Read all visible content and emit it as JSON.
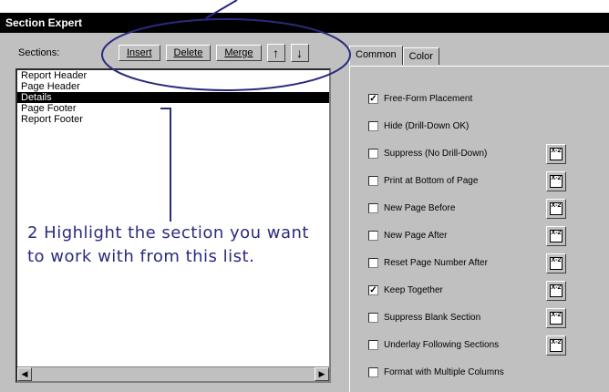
{
  "window": {
    "title": "Section Expert"
  },
  "sections_label": "Sections:",
  "toolbar": {
    "insert_label": "Insert",
    "delete_label": "Delete",
    "merge_label": "Merge",
    "up_icon": "arrow-up-icon",
    "down_icon": "arrow-down-icon"
  },
  "sections": [
    {
      "label": "Report Header",
      "selected": false
    },
    {
      "label": "Page Header",
      "selected": false
    },
    {
      "label": "Details",
      "selected": true
    },
    {
      "label": "Page Footer",
      "selected": false
    },
    {
      "label": "Report Footer",
      "selected": false
    }
  ],
  "annotation": {
    "line1": "2 Highlight the section you want",
    "line2": "to work with from this list."
  },
  "tabs": [
    {
      "label": "Common",
      "active": true
    },
    {
      "label": "Color",
      "active": false
    }
  ],
  "options": [
    {
      "label": "Free-Form Placement",
      "checked": true,
      "has_formula": false
    },
    {
      "label": "Hide (Drill-Down OK)",
      "checked": false,
      "has_formula": false
    },
    {
      "label": "Suppress (No Drill-Down)",
      "checked": false,
      "has_formula": true
    },
    {
      "label": "Print at Bottom of Page",
      "checked": false,
      "has_formula": true
    },
    {
      "label": "New Page Before",
      "checked": false,
      "has_formula": true
    },
    {
      "label": "New Page After",
      "checked": false,
      "has_formula": true
    },
    {
      "label": "Reset Page Number After",
      "checked": false,
      "has_formula": true
    },
    {
      "label": "Keep Together",
      "checked": true,
      "has_formula": true
    },
    {
      "label": "Suppress Blank Section",
      "checked": false,
      "has_formula": true
    },
    {
      "label": "Underlay Following Sections",
      "checked": false,
      "has_formula": true
    },
    {
      "label": "Format with Multiple Columns",
      "checked": false,
      "has_formula": false
    }
  ],
  "formula_button_text": "X-2",
  "colors": {
    "annotation": "#2a2a80",
    "titlebar": "#000000",
    "dialog": "#c0c0c0"
  }
}
